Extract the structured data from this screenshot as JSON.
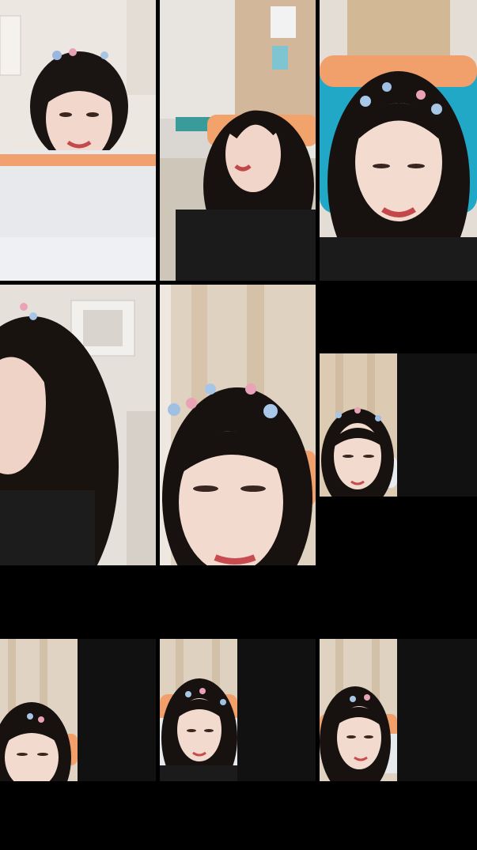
{
  "layout": {
    "background_color": "#000000",
    "tile_count": 9
  },
  "tiles": [
    {
      "id": "participant-1",
      "icon": "person-video-icon",
      "state": "live"
    },
    {
      "id": "participant-2",
      "icon": "person-video-icon",
      "state": "live"
    },
    {
      "id": "participant-3",
      "icon": "person-video-icon",
      "state": "live"
    },
    {
      "id": "participant-4",
      "icon": "person-video-icon",
      "state": "live"
    },
    {
      "id": "participant-5",
      "icon": "person-video-icon",
      "state": "live"
    },
    {
      "id": "participant-6",
      "icon": "person-video-icon",
      "state": "loading"
    },
    {
      "id": "participant-7",
      "icon": "person-video-icon",
      "state": "loading"
    },
    {
      "id": "participant-8",
      "icon": "person-video-icon",
      "state": "loading"
    },
    {
      "id": "participant-9",
      "icon": "person-video-icon",
      "state": "loading"
    }
  ],
  "colors": {
    "wall": "#d9d2c9",
    "curtain": "#d8c7b2",
    "hair": "#17120f",
    "skin": "#f0d6ca",
    "shirt": "#1a1a1a",
    "sofa_blue": "#22a9c7",
    "sofa_orange": "#f2a26b",
    "loading_panel": "#0e0e0e"
  }
}
